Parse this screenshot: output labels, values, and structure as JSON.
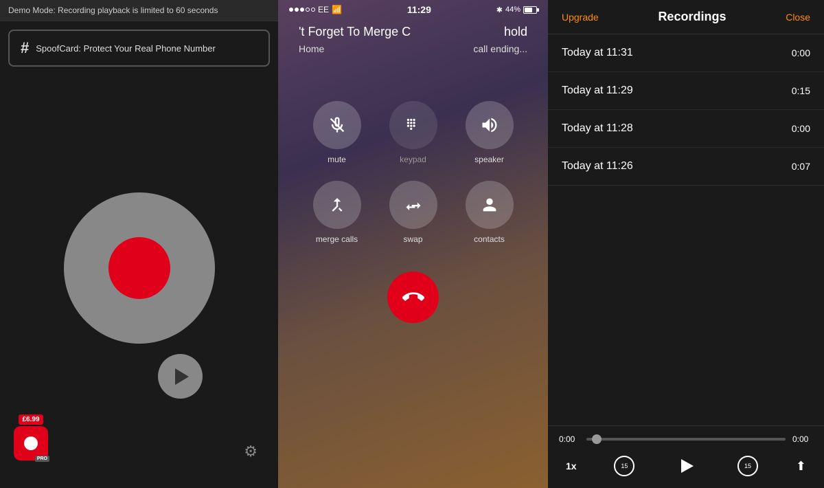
{
  "left": {
    "demo_banner": "Demo Mode: Recording playback is limited to 60 seconds",
    "spoof_ad": "SpoofCard: Protect Your Real Phone Number",
    "hash_symbol": "#",
    "price": "£6.99",
    "pro_label": "PRO"
  },
  "phone": {
    "carrier": "EE",
    "time": "11:29",
    "battery": "44%",
    "call_header_left": "'t Forget To Merge C",
    "call_header_right": "hold",
    "call_name": "Home",
    "call_status": "call ending...",
    "mute_label": "mute",
    "keypad_label": "keypad",
    "speaker_label": "speaker",
    "merge_label": "merge calls",
    "swap_label": "swap",
    "contacts_label": "contacts"
  },
  "recordings": {
    "title": "Recordings",
    "upgrade_label": "Upgrade",
    "close_label": "Close",
    "items": [
      {
        "time": "Today at 11:31",
        "duration": "0:00"
      },
      {
        "time": "Today at 11:29",
        "duration": "0:15"
      },
      {
        "time": "Today at 11:28",
        "duration": "0:00"
      },
      {
        "time": "Today at 11:26",
        "duration": "0:07"
      }
    ],
    "playback": {
      "current": "0:00",
      "total": "0:00",
      "speed": "1x",
      "rewind_label": "15",
      "forward_label": "15"
    }
  }
}
